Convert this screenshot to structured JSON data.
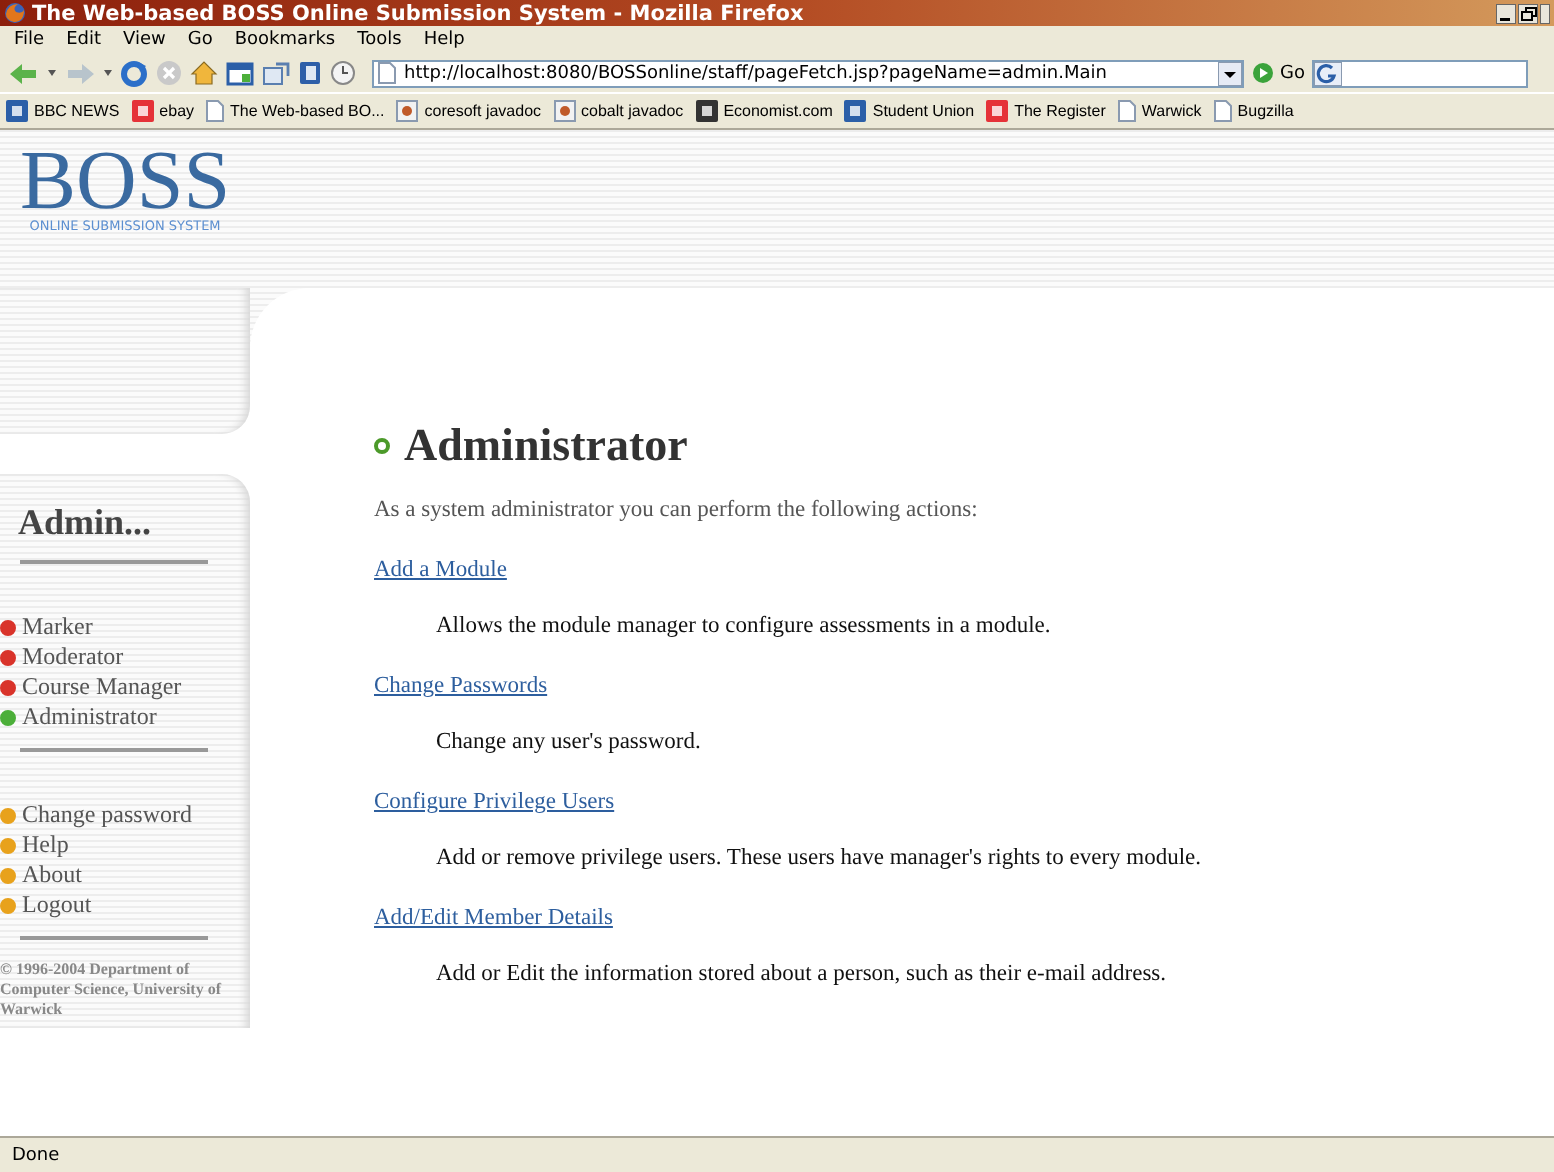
{
  "window": {
    "title": "The Web-based BOSS Online Submission System - Mozilla Firefox"
  },
  "menu": [
    {
      "label": "File"
    },
    {
      "label": "Edit"
    },
    {
      "label": "View"
    },
    {
      "label": "Go"
    },
    {
      "label": "Bookmarks"
    },
    {
      "label": "Tools"
    },
    {
      "label": "Help"
    }
  ],
  "address_bar": {
    "value": "http://localhost:8080/BOSSonline/staff/pageFetch.jsp?pageName=admin.Main",
    "go_button": "Go"
  },
  "bookmarks": [
    {
      "label": "BBC NEWS",
      "kind": "site"
    },
    {
      "label": "ebay",
      "kind": "site"
    },
    {
      "label": "The Web-based BO...",
      "kind": "page"
    },
    {
      "label": "coresoft javadoc",
      "kind": "doc"
    },
    {
      "label": "cobalt javadoc",
      "kind": "doc"
    },
    {
      "label": "Economist.com",
      "kind": "site"
    },
    {
      "label": "Student Union",
      "kind": "site"
    },
    {
      "label": "The Register",
      "kind": "site"
    },
    {
      "label": "Warwick",
      "kind": "page"
    },
    {
      "label": "Bugzilla",
      "kind": "page"
    }
  ],
  "logo": {
    "title": "BOSS",
    "subtitle": "ONLINE SUBMISSION SYSTEM"
  },
  "sidebar": {
    "heading": "Admin...",
    "groups": [
      [
        {
          "label": "Marker",
          "color": "#d9342b"
        },
        {
          "label": "Moderator",
          "color": "#d9342b"
        },
        {
          "label": "Course Manager",
          "color": "#d9342b"
        },
        {
          "label": "Administrator",
          "color": "#4caf3a"
        }
      ],
      [
        {
          "label": "Change password",
          "color": "#e8a21c"
        },
        {
          "label": "Help",
          "color": "#e8a21c"
        },
        {
          "label": "About",
          "color": "#e8a21c"
        },
        {
          "label": "Logout",
          "color": "#e8a21c"
        }
      ]
    ],
    "copyright": "© 1996-2004 Department of Computer Science, University of Warwick"
  },
  "main": {
    "heading": "Administrator",
    "intro": "As a system administrator you can perform the following actions:",
    "actions": [
      {
        "link": "Add a Module",
        "description": "Allows the module manager to configure assessments in a module."
      },
      {
        "link": "Change Passwords",
        "description": "Change any user's password."
      },
      {
        "link": "Configure Privilege Users",
        "description": "Add or remove privilege users. These users have manager's rights to every module."
      },
      {
        "link": "Add/Edit Member Details",
        "description": "Add or Edit the information stored about a person, such as their e-mail address."
      }
    ]
  },
  "status_bar": {
    "text": "Done"
  }
}
